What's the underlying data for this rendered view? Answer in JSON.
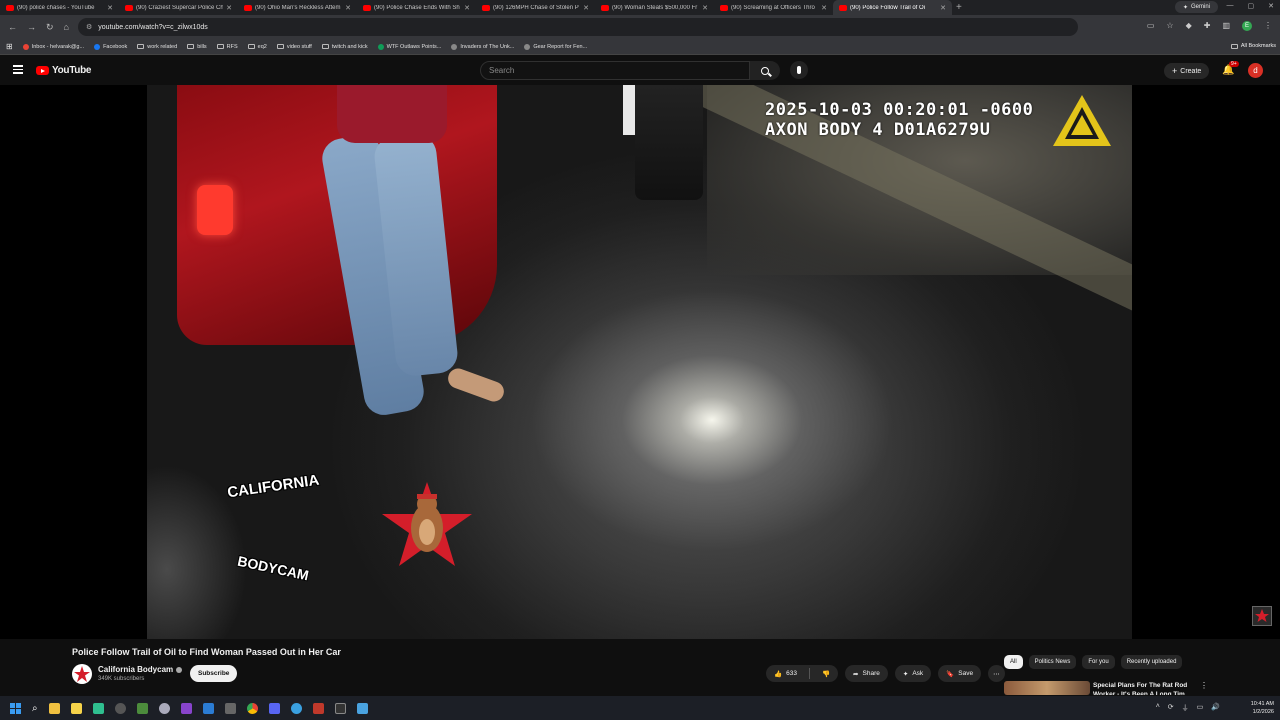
{
  "browser": {
    "tabs": [
      {
        "title": "(90) police chases - YouTube",
        "active": false
      },
      {
        "title": "(90) Craziest Supercar Police Ch",
        "active": false
      },
      {
        "title": "(90) Ohio Man's Reckless Attem",
        "active": false
      },
      {
        "title": "(90) Police Chase Ends With Sh",
        "active": false
      },
      {
        "title": "(90) 126MPH Chase of Stolen P",
        "active": false
      },
      {
        "title": "(90) Woman Steals $500,000 Fr",
        "active": false
      },
      {
        "title": "(90) Screaming at Officers Thro",
        "active": false
      },
      {
        "title": "(90) Police Follow Trail of Oi",
        "active": true
      }
    ],
    "gemini_label": "Gemini",
    "url": "youtube.com/watch?v=c_zilwx10ds",
    "profile_initial": "E",
    "bookmarks": [
      {
        "label": "Inbox - helvarak@g...",
        "icon": "gmail-icon"
      },
      {
        "label": "Facebook",
        "icon": "facebook-icon"
      },
      {
        "label": "work related",
        "icon": "folder-icon"
      },
      {
        "label": "bills",
        "icon": "folder-icon"
      },
      {
        "label": "RFS",
        "icon": "folder-icon"
      },
      {
        "label": "eq2",
        "icon": "folder-icon"
      },
      {
        "label": "video stuff",
        "icon": "folder-icon"
      },
      {
        "label": "twitch and kick",
        "icon": "folder-icon"
      },
      {
        "label": "WTF Outlaws Points...",
        "icon": "sheets-icon"
      },
      {
        "label": "Invaders of The Unk...",
        "icon": "web-icon"
      },
      {
        "label": "Gear Report for Fen...",
        "icon": "web-icon"
      }
    ],
    "all_bookmarks_label": "All Bookmarks"
  },
  "youtube": {
    "logo_text": "YouTube",
    "search_placeholder": "Search",
    "create_label": "Create",
    "notification_count": "9+",
    "user_initial": "d"
  },
  "video": {
    "timestamp": "2025-10-03 00:20:01 -0600",
    "camera_id": "AXON BODY 4 D01A6279U",
    "overlay_top": "CALIFORNIA",
    "overlay_bottom": "BODYCAM",
    "title": "Police Follow Trail of Oil to Find Woman Passed Out in Her Car",
    "channel_name": "California Bodycam",
    "subscribers": "349K subscribers",
    "subscribe_label": "Subscribe",
    "likes": "633",
    "share_label": "Share",
    "ask_label": "Ask",
    "save_label": "Save"
  },
  "sidebar": {
    "chips": [
      {
        "label": "All",
        "selected": true
      },
      {
        "label": "Politics News",
        "selected": false
      },
      {
        "label": "For you",
        "selected": false
      },
      {
        "label": "Recently uploaded",
        "selected": false
      }
    ],
    "rec_title": "Special Plans For The Rat Rod Worker - It's Been A Long Tim..."
  },
  "taskbar": {
    "time": "10:41 AM",
    "date": "1/2/2026"
  },
  "colors": {
    "yt_red": "#ff0000",
    "bg": "#0f0f0f",
    "chrome_bar": "#35363a"
  }
}
